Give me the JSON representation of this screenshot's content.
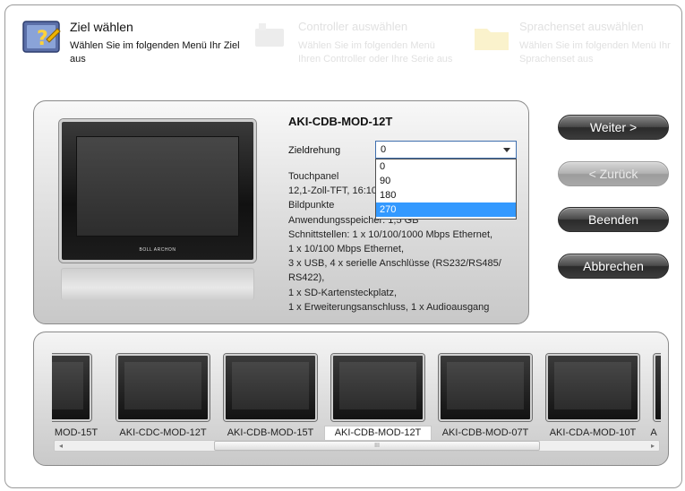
{
  "wizard": {
    "steps": [
      {
        "title": "Ziel wählen",
        "desc": "Wählen Sie im folgenden Menü Ihr Ziel aus"
      },
      {
        "title": "Controller auswählen",
        "desc": "Wählen Sie im folgenden Menü Ihren Controller oder Ihre Serie aus"
      },
      {
        "title": "Sprachenset auswählen",
        "desc": "Wählen Sie im folgenden Menü Ihr Sprachenset aus"
      }
    ]
  },
  "detail": {
    "model": "AKI-CDB-MOD-12T",
    "rotation_label": "Zieldrehung",
    "rotation_value": "0",
    "rotation_options": [
      "0",
      "90",
      "180",
      "270"
    ],
    "rotation_highlight": "270",
    "device_brand": "BOLL ARCHON",
    "specs": [
      "Touchpanel",
      "12,1-Zoll-TFT, 16:10",
      "Bildpunkte",
      "Anwendungsspeicher: 1,5 GB",
      "Schnittstellen: 1 x 10/100/1000 Mbps Ethernet,",
      "1 x 10/100 Mbps Ethernet,",
      "3 x USB, 4 x serielle Anschlüsse (RS232/RS485/",
      "RS422),",
      "1 x SD-Kartensteckplatz,",
      "1 x Erweiterungsanschluss, 1 x Audioausgang"
    ]
  },
  "buttons": {
    "next": "Weiter >",
    "back": "< Zurück",
    "finish": "Beenden",
    "cancel": "Abbrechen"
  },
  "gallery": {
    "items": [
      {
        "label": "MOD-15T"
      },
      {
        "label": "AKI-CDC-MOD-12T"
      },
      {
        "label": "AKI-CDB-MOD-15T"
      },
      {
        "label": "AKI-CDB-MOD-12T"
      },
      {
        "label": "AKI-CDB-MOD-07T"
      },
      {
        "label": "AKI-CDA-MOD-10T"
      },
      {
        "label": "A"
      }
    ],
    "selected": "AKI-CDB-MOD-12T",
    "scroll_grip": "III"
  }
}
